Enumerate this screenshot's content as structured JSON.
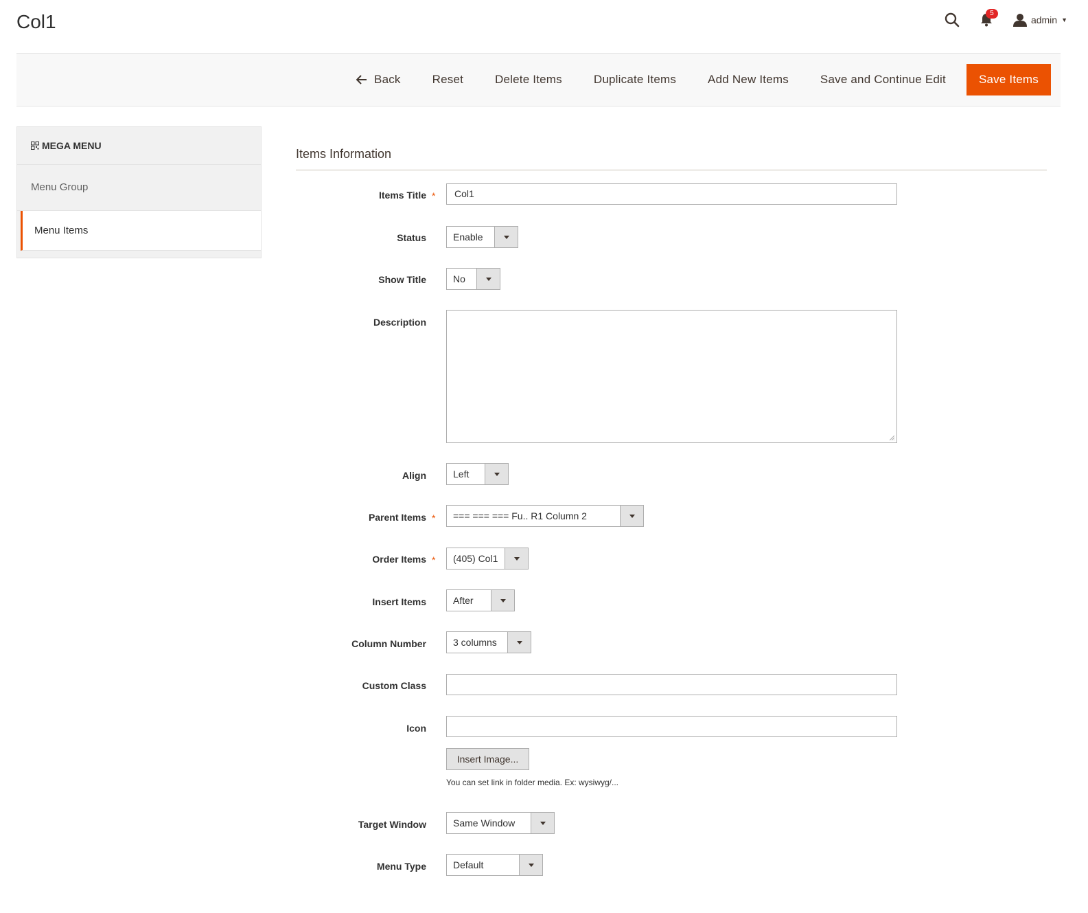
{
  "header": {
    "page_title": "Col1",
    "notifications_count": "5",
    "user_name": "admin"
  },
  "toolbar": {
    "back_label": "Back",
    "reset_label": "Reset",
    "delete_label": "Delete Items",
    "duplicate_label": "Duplicate Items",
    "add_new_label": "Add New Items",
    "save_continue_label": "Save and Continue Edit",
    "save_label": "Save Items"
  },
  "sidebar": {
    "title": "MEGA MENU",
    "items": [
      {
        "label": "Menu Group"
      },
      {
        "label": "Menu Items"
      }
    ]
  },
  "form": {
    "section_title": "Items Information",
    "required_marker": "*",
    "fields": {
      "items_title": {
        "label": "Items Title",
        "value": "Col1"
      },
      "status": {
        "label": "Status",
        "value": "Enable"
      },
      "show_title": {
        "label": "Show Title",
        "value": "No"
      },
      "description": {
        "label": "Description",
        "value": ""
      },
      "align": {
        "label": "Align",
        "value": "Left"
      },
      "parent_items": {
        "label": "Parent Items",
        "value": "=== === === Fu.. R1 Column 2"
      },
      "order_items": {
        "label": "Order Items",
        "value": "(405) Col1"
      },
      "insert_items": {
        "label": "Insert Items",
        "value": "After"
      },
      "column_number": {
        "label": "Column Number",
        "value": "3 columns"
      },
      "custom_class": {
        "label": "Custom Class",
        "value": ""
      },
      "icon": {
        "label": "Icon",
        "value": "",
        "insert_button": "Insert Image...",
        "note": "You can set link in folder media. Ex: wysiwyg/..."
      },
      "target_window": {
        "label": "Target Window",
        "value": "Same Window"
      },
      "menu_type": {
        "label": "Menu Type",
        "value": "Default"
      }
    }
  },
  "colors": {
    "accent": "#eb5202",
    "badge": "#e22626",
    "toolbar_bg": "#f8f8f8",
    "sidebar_bg": "#f1f1f1"
  },
  "icons": {
    "search": "search-icon",
    "bell": "bell-icon",
    "user": "user-icon",
    "back": "arrow-left-icon",
    "mega_menu": "grid-icon"
  }
}
